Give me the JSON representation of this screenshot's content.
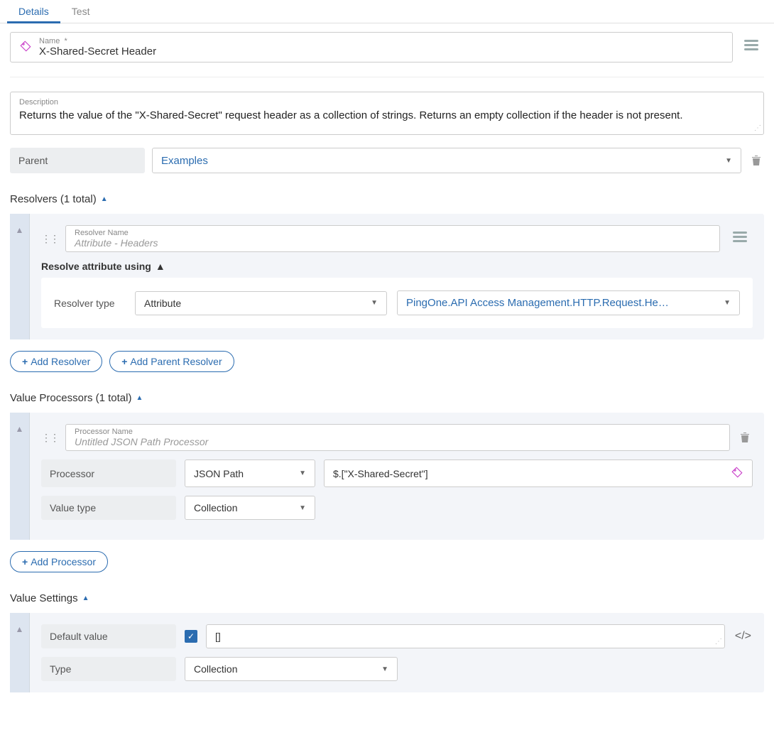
{
  "tabs": {
    "details": "Details",
    "test": "Test"
  },
  "name": {
    "label": "Name",
    "required": "*",
    "value": "X-Shared-Secret Header"
  },
  "description": {
    "label": "Description",
    "value": "Returns the value of the \"X-Shared-Secret\" request header as a collection of strings. Returns an empty collection if the header is not present."
  },
  "parent": {
    "label": "Parent",
    "value": "Examples"
  },
  "resolvers": {
    "header": "Resolvers (1 total)",
    "item": {
      "name_label": "Resolver Name",
      "name_value": "Attribute - Headers",
      "sub_header": "Resolve attribute using",
      "type_label": "Resolver type",
      "type_value": "Attribute",
      "attr_value": "PingOne.API Access Management.HTTP.Request.He…"
    },
    "add": "Add Resolver",
    "add_parent": "Add Parent Resolver"
  },
  "processors": {
    "header": "Value Processors (1 total)",
    "item": {
      "name_label": "Processor Name",
      "name_value": "Untitled JSON Path Processor",
      "proc_label": "Processor",
      "proc_value": "JSON Path",
      "path_value": "$.[\"X-Shared-Secret\"]",
      "valtype_label": "Value type",
      "valtype_value": "Collection"
    },
    "add": "Add Processor"
  },
  "settings": {
    "header": "Value Settings",
    "default_label": "Default value",
    "default_value": "[]",
    "type_label": "Type",
    "type_value": "Collection"
  }
}
